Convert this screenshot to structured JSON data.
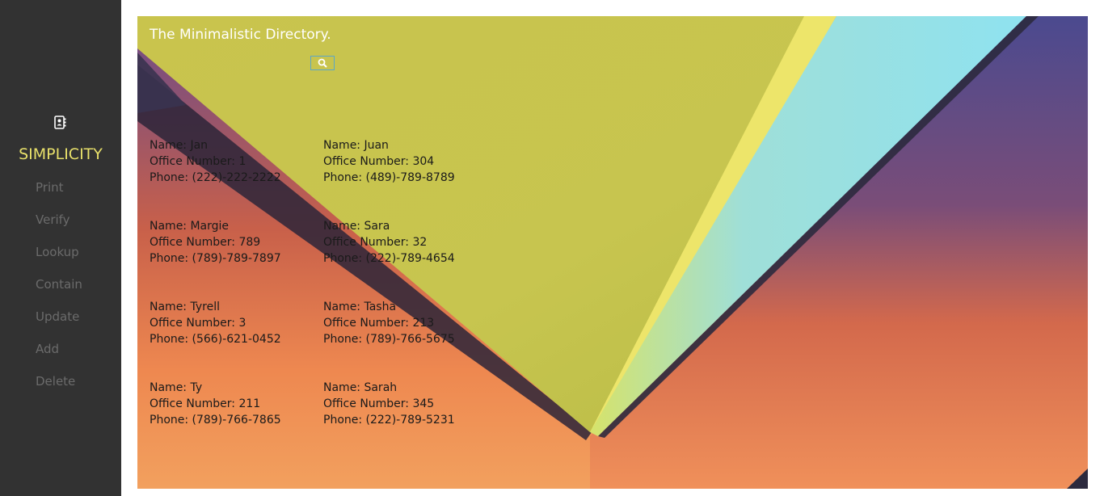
{
  "sidebar": {
    "brand_icon": "address-book-icon",
    "brand": "SIMPLICITY",
    "items": [
      {
        "label": "Print"
      },
      {
        "label": "Verify"
      },
      {
        "label": "Lookup"
      },
      {
        "label": "Contain"
      },
      {
        "label": "Update"
      },
      {
        "label": "Add"
      },
      {
        "label": "Delete"
      }
    ]
  },
  "header": {
    "title": "The Minimalistic Directory.",
    "search_icon": "search-icon"
  },
  "directory": [
    {
      "name": "Name: Jan",
      "office": "Office Number: 1",
      "phone": "Phone: (222)-222-2222"
    },
    {
      "name": "Name: Juan",
      "office": "Office Number: 304",
      "phone": "Phone: (489)-789-8789"
    },
    {
      "name": "Name: Margie",
      "office": "Office Number: 789",
      "phone": "Phone: (789)-789-7897"
    },
    {
      "name": "Name: Sara",
      "office": "Office Number: 32",
      "phone": "Phone: (222)-789-4654"
    },
    {
      "name": "Name: Tyrell",
      "office": "Office Number: 3",
      "phone": "Phone: (566)-621-0452"
    },
    {
      "name": "Name: Tasha",
      "office": "Office Number: 213",
      "phone": "Phone: (789)-766-5675"
    },
    {
      "name": "Name: Ty",
      "office": "Office Number: 211",
      "phone": "Phone: (789)-766-7865"
    },
    {
      "name": "Name: Sarah",
      "office": "Office Number: 345",
      "phone": "Phone: (222)-789-5231"
    }
  ],
  "colors": {
    "sidebar_bg": "#323232",
    "brand": "#e8e06a",
    "nav_text": "#6b6b6b",
    "search_border": "#5aa6c8"
  }
}
